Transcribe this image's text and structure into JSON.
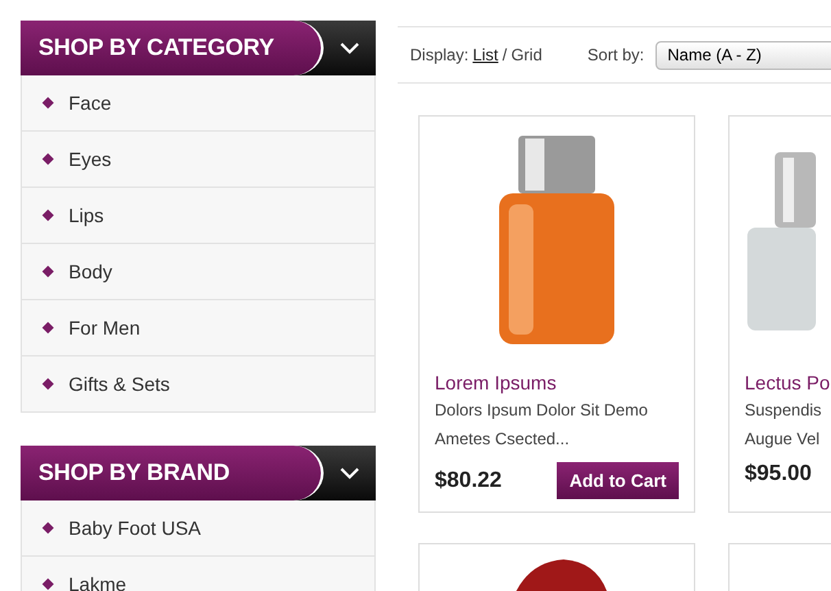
{
  "sidebar": [
    {
      "title": "SHOP BY CATEGORY",
      "expanded": true,
      "items": [
        "Face",
        "Eyes",
        "Lips",
        "Body",
        "For Men",
        "Gifts & Sets"
      ]
    },
    {
      "title": "SHOP BY BRAND",
      "expanded": true,
      "items": [
        "Baby Foot USA",
        "Lakme"
      ]
    }
  ],
  "toolbar": {
    "display_label": "Display:",
    "display_options": [
      {
        "label": "List",
        "selected": true
      },
      {
        "label": "Grid",
        "selected": false
      }
    ],
    "separator": "/",
    "sort_label": "Sort by:",
    "sort_value": "Name (A - Z)"
  },
  "products": [
    {
      "kind": "bottle-orange",
      "name": "Lorem Ipsums",
      "description": [
        "Dolors Ipsum Dolor Sit Demo",
        "Ametes Csected..."
      ],
      "price": "$80.22",
      "button": "Add to Cart"
    },
    {
      "kind": "bottle-clear",
      "name": "Lectus Po",
      "description": [
        "Suspendis",
        "Augue Vel"
      ],
      "price": "$95.00"
    },
    {
      "kind": "shoe-red"
    },
    {
      "kind": "blank"
    }
  ]
}
